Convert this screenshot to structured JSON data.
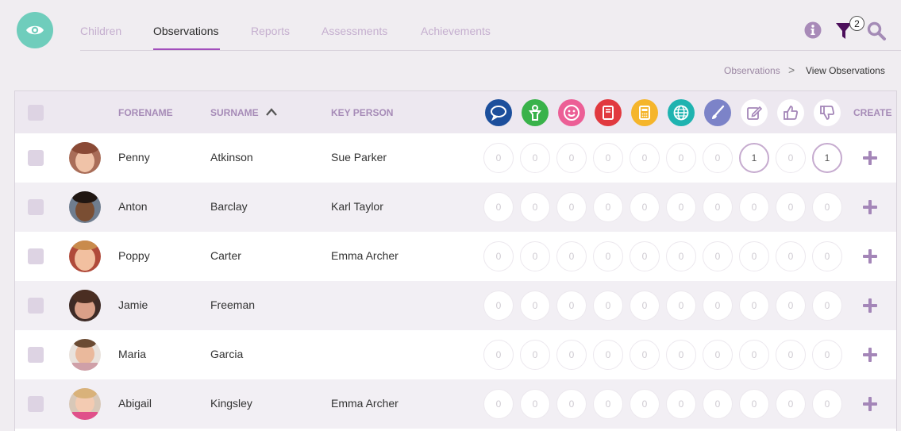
{
  "nav": {
    "tabs": [
      {
        "label": "Children"
      },
      {
        "label": "Observations"
      },
      {
        "label": "Reports"
      },
      {
        "label": "Assessments"
      },
      {
        "label": "Achievements"
      }
    ],
    "active_tab": "Observations",
    "filter_count": "2"
  },
  "breadcrumb": {
    "parent": "Observations",
    "separator": ">",
    "current": "View Observations"
  },
  "table": {
    "headers": {
      "forename": "FORENAME",
      "surname": "SURNAME",
      "key_person": "KEY PERSON",
      "create": "CREATE"
    },
    "sort": {
      "column": "surname",
      "direction": "ascending"
    },
    "category_icons": [
      {
        "name": "speech-bubble-icon",
        "color": "#1c4f9c"
      },
      {
        "name": "person-icon",
        "color": "#39b24a"
      },
      {
        "name": "smiley-icon",
        "color": "#ec5f96"
      },
      {
        "name": "book-icon",
        "color": "#e1393f"
      },
      {
        "name": "calculator-icon",
        "color": "#f5b52b"
      },
      {
        "name": "globe-icon",
        "color": "#1fb3b0"
      },
      {
        "name": "paintbrush-icon",
        "color": "#7c83c8"
      },
      {
        "name": "edit-icon",
        "color": "#ffffff"
      },
      {
        "name": "thumbs-up-icon",
        "color": "#ffffff"
      },
      {
        "name": "thumbs-down-icon",
        "color": "#ffffff"
      }
    ],
    "rows": [
      {
        "forename": "Penny",
        "surname": "Atkinson",
        "key_person": "Sue Parker",
        "counts": [
          "0",
          "0",
          "0",
          "0",
          "0",
          "0",
          "0",
          "1",
          "0",
          "1"
        ]
      },
      {
        "forename": "Anton",
        "surname": "Barclay",
        "key_person": "Karl Taylor",
        "counts": [
          "0",
          "0",
          "0",
          "0",
          "0",
          "0",
          "0",
          "0",
          "0",
          "0"
        ]
      },
      {
        "forename": "Poppy",
        "surname": "Carter",
        "key_person": "Emma Archer",
        "counts": [
          "0",
          "0",
          "0",
          "0",
          "0",
          "0",
          "0",
          "0",
          "0",
          "0"
        ]
      },
      {
        "forename": "Jamie",
        "surname": "Freeman",
        "key_person": "",
        "counts": [
          "0",
          "0",
          "0",
          "0",
          "0",
          "0",
          "0",
          "0",
          "0",
          "0"
        ]
      },
      {
        "forename": "Maria",
        "surname": "Garcia",
        "key_person": "",
        "counts": [
          "0",
          "0",
          "0",
          "0",
          "0",
          "0",
          "0",
          "0",
          "0",
          "0"
        ]
      },
      {
        "forename": "Abigail",
        "surname": "Kingsley",
        "key_person": "Emma Archer",
        "counts": [
          "0",
          "0",
          "0",
          "0",
          "0",
          "0",
          "0",
          "0",
          "0",
          "0"
        ]
      }
    ]
  },
  "colors": {
    "accent": "#a24ebc",
    "logo": "#6fcdbc",
    "icon_purple": "#a486b8"
  }
}
